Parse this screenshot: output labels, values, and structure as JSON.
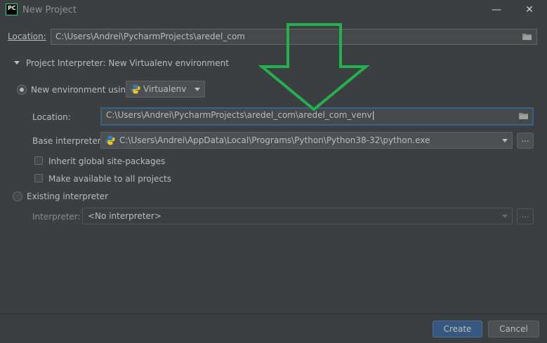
{
  "window": {
    "title": "New Project",
    "logo_text": "PC",
    "minimize_glyph": "—",
    "close_glyph": "✕"
  },
  "project": {
    "location_label": "Location:",
    "location_value": "C:\\Users\\Andrei\\PycharmProjects\\aredel_com"
  },
  "interpreter_section": {
    "title": "Project Interpreter: New Virtualenv environment",
    "expanded": true
  },
  "new_env": {
    "radio_label": "New environment using",
    "selected": true,
    "env_type": "Virtualenv",
    "location_label": "Location:",
    "location_value": "C:\\Users\\Andrei\\PycharmProjects\\aredel_com\\aredel_com_venv",
    "base_label": "Base interpreter:",
    "base_value": "C:\\Users\\Andrei\\AppData\\Local\\Programs\\Python\\Python38-32\\python.exe",
    "inherit_label": "Inherit global site-packages",
    "inherit_checked": false,
    "make_available_label": "Make available to all projects",
    "make_available_checked": false,
    "browse_label": "..."
  },
  "existing": {
    "radio_label": "Existing interpreter",
    "selected": false,
    "interpreter_label": "Interpreter:",
    "interpreter_value": "<No interpreter>",
    "browse_label": "..."
  },
  "buttons": {
    "create": "Create",
    "cancel": "Cancel"
  },
  "icons": {
    "folder": "folder-icon",
    "python": "python-icon",
    "annotation_arrow": "down-arrow-annotation",
    "arrow_color": "#22b14c"
  }
}
